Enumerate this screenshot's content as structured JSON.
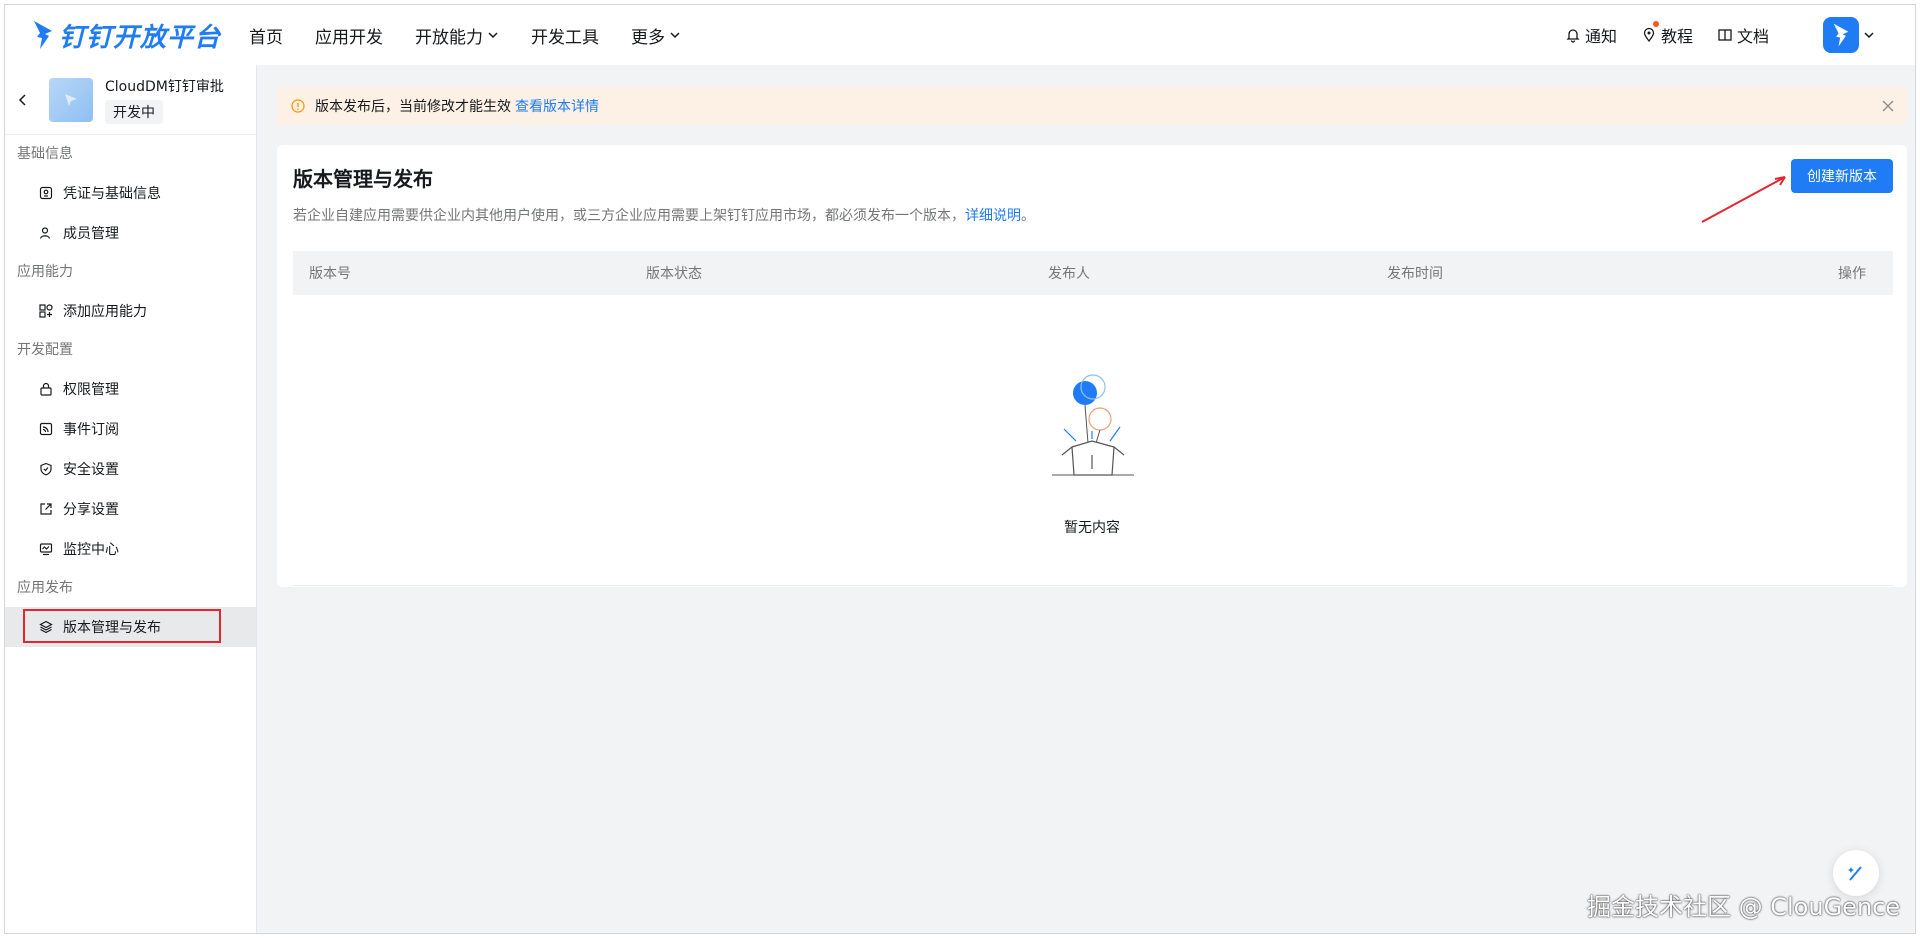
{
  "brand": {
    "name": "钉钉开放平台",
    "color": "#1f7cf5"
  },
  "nav": {
    "items": [
      {
        "label": "首页",
        "dropdown": false
      },
      {
        "label": "应用开发",
        "dropdown": false
      },
      {
        "label": "开放能力",
        "dropdown": true
      },
      {
        "label": "开发工具",
        "dropdown": false
      },
      {
        "label": "更多",
        "dropdown": true
      }
    ],
    "right": {
      "notice": "通知",
      "tutorial": "教程",
      "docs": "文档"
    }
  },
  "app": {
    "name": "CloudDM钉钉审批",
    "status": "开发中"
  },
  "sidebar": {
    "groups": [
      {
        "title": "基础信息",
        "items": [
          {
            "label": "凭证与基础信息",
            "icon": "credential-icon"
          },
          {
            "label": "成员管理",
            "icon": "member-icon"
          }
        ]
      },
      {
        "title": "应用能力",
        "items": [
          {
            "label": "添加应用能力",
            "icon": "apps-icon"
          }
        ]
      },
      {
        "title": "开发配置",
        "items": [
          {
            "label": "权限管理",
            "icon": "lock-icon"
          },
          {
            "label": "事件订阅",
            "icon": "rss-icon"
          },
          {
            "label": "安全设置",
            "icon": "shield-icon"
          },
          {
            "label": "分享设置",
            "icon": "share-icon"
          },
          {
            "label": "监控中心",
            "icon": "monitor-icon"
          }
        ]
      },
      {
        "title": "应用发布",
        "items": [
          {
            "label": "版本管理与发布",
            "icon": "layers-icon",
            "active": true
          }
        ]
      }
    ]
  },
  "notice": {
    "text": "版本发布后，当前修改才能生效",
    "link": "查看版本详情"
  },
  "card": {
    "title": "版本管理与发布",
    "desc": "若企业自建应用需要供企业内其他用户使用，或三方企业应用需要上架钉钉应用市场，都必须发布一个版本，",
    "desc_link": "详细说明",
    "desc_end": "。",
    "create_button": "创建新版本"
  },
  "table": {
    "columns": [
      "版本号",
      "版本状态",
      "发布人",
      "发布时间",
      "操作"
    ],
    "rows": [],
    "empty_text": "暂无内容"
  },
  "watermark": "掘金技术社区 @ ClouGence"
}
